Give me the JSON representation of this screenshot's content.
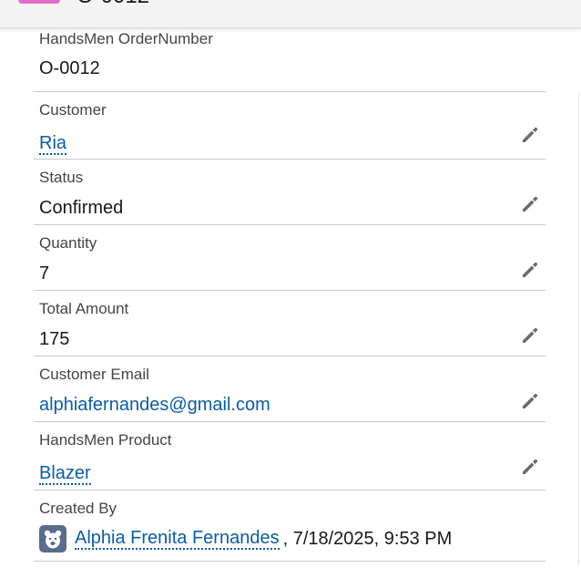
{
  "header": {
    "record_title": "O-0012"
  },
  "colors": {
    "accent_link": "#0b5cab",
    "record_icon": "#e46ec6",
    "avatar_bg": "#5a6c8c"
  },
  "fields": {
    "order_number": {
      "label": "HandsMen OrderNumber",
      "value": "O-0012"
    },
    "customer": {
      "label": "Customer",
      "value": "Ria"
    },
    "status": {
      "label": "Status",
      "value": "Confirmed"
    },
    "quantity": {
      "label": "Quantity",
      "value": "7"
    },
    "total_amount": {
      "label": "Total Amount",
      "value": "175"
    },
    "customer_email": {
      "label": "Customer Email",
      "value": "alphiafernandes@gmail.com"
    },
    "product": {
      "label": "HandsMen Product",
      "value": "Blazer"
    },
    "created_by": {
      "label": "Created By",
      "user": "Alphia Frenita Fernandes",
      "date": ", 7/18/2025, 9:53 PM",
      "avatar_icon": "bear-avatar-icon"
    }
  },
  "icons": {
    "edit": "pencil-icon"
  }
}
